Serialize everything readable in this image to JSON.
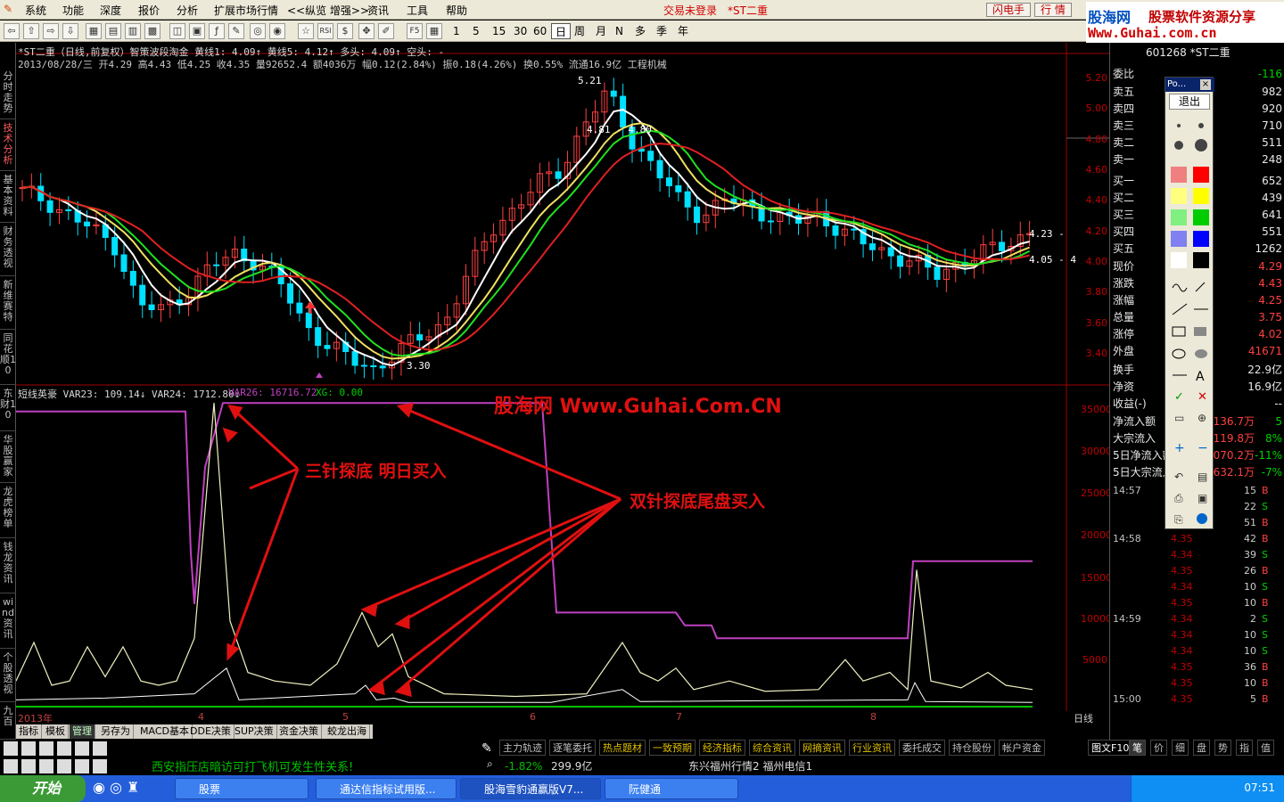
{
  "menu": {
    "items": [
      "系统",
      "功能",
      "深度",
      "报价",
      "分析",
      "扩展市场行情",
      "<<纵览 增强>>",
      "资讯",
      "工具",
      "帮助"
    ],
    "status": "交易未登录",
    "stock": "*ST二重",
    "btn_flash": "闪电手",
    "btn_quote": "行 情"
  },
  "brand": {
    "line1a": "股海网",
    "line1b": "股票软件资源分享",
    "line2": "Www.Guhai.com.cn"
  },
  "toolbar": {
    "periods": [
      "1",
      "5",
      "15",
      "30",
      "60",
      "日",
      "周",
      "月",
      "N",
      "多",
      "季",
      "年"
    ],
    "selected_period": "日",
    "icons": [
      "back-icon",
      "forward-icon",
      "up-icon",
      "down-icon",
      "home-icon",
      "list-icon",
      "chart-icon",
      "bars-icon",
      "draw-icon",
      "fx-icon",
      "find-icon",
      "star-icon",
      "rsi-icon",
      "money-icon",
      "move-icon",
      "pencil-icon",
      "f5-icon",
      "f6-icon",
      "f10-icon"
    ]
  },
  "leftnav": [
    "分时走势",
    "技术分析",
    "基本资料",
    "财务透视",
    "新维赛特",
    "同花顺10",
    "东财10",
    "华股赢家",
    "龙虎榜单",
    "钱龙资讯",
    "wind资讯",
    "个股透视",
    "九百"
  ],
  "chart": {
    "header1": "*ST二重（日线,前复权）智策波段淘金 黄线1: 4.09↑ 黄线5: 4.12↑ 多头: 4.09↑ 空头: -",
    "header2": "2013/08/28/三 开4.29 高4.43 低4.25 收4.35 量92652.4 额4036万 幅0.12(2.84%) 振0.18(4.26%) 换0.55% 流通16.9亿 工程机械",
    "ind_header_a": "短线英豪 VAR23: 109.14↓ VAR24: 1712.80↓",
    "ind_header_b": "VAR26: 16716.72",
    "ind_header_c": "XG: 0.00",
    "price_high": "5.21",
    "price_mid": "4.81 - 4.80",
    "price_low": "3.30",
    "price_last": "4.23 -",
    "price_right": "4.05 - 4",
    "watermark": "股海网 Www.Guhai.Com.CN",
    "annot1": "三针探底 明日买入",
    "annot2": "双针探底尾盘买入",
    "y1_ticks": [
      "5.20",
      "5.00",
      "4.80",
      "4.60",
      "4.40",
      "4.20",
      "4.00",
      "3.80",
      "3.60",
      "3.40"
    ],
    "y2_ticks": [
      "35000",
      "30000",
      "25000",
      "20000",
      "15000",
      "10000",
      "5000"
    ],
    "date_labels": [
      "2013年",
      "4",
      "5",
      "6",
      "7",
      "8"
    ],
    "period_label": "日线"
  },
  "tabs": [
    "指标",
    "模板",
    "管理",
    "另存为",
    "MACD基本",
    "DDE决策",
    "SUP决策",
    "资金决策",
    "蛟龙出海"
  ],
  "active_tab": "管理",
  "bottom_tabs": [
    "主力轨迹",
    "逐笔委托",
    "热点题材",
    "一致预期",
    "经济指标",
    "综合资讯",
    "网摘资讯",
    "行业资讯",
    "委托成交",
    "持仓股份",
    "帐户资金"
  ],
  "ticker": "西安指压店暗访可打飞机可发生性关系!",
  "index_change": "-1.82%",
  "index_amount": "299.9亿",
  "index_names": "东兴福州行情2  福州电信1",
  "right": {
    "code": "601268 *ST二重",
    "weibi_label": "委比",
    "weibi": "-116",
    "asks": [
      {
        "l": "卖五",
        "v": "982"
      },
      {
        "l": "卖四",
        "v": "920"
      },
      {
        "l": "卖三",
        "v": "710"
      },
      {
        "l": "卖二",
        "v": "511"
      },
      {
        "l": "卖一",
        "v": "248"
      }
    ],
    "bids": [
      {
        "l": "买一",
        "v": "652"
      },
      {
        "l": "买二",
        "v": "439"
      },
      {
        "l": "买三",
        "v": "641"
      },
      {
        "l": "买四",
        "v": "551"
      },
      {
        "l": "买五",
        "v": "1262"
      }
    ],
    "stats": [
      {
        "l": "现价",
        "v": "4.29"
      },
      {
        "l": "涨跌",
        "v": "4.43"
      },
      {
        "l": "涨幅",
        "v": "4.25"
      },
      {
        "l": "总量",
        "v": "3.75"
      },
      {
        "l": "涨停",
        "v": "4.02"
      },
      {
        "l": "外盘",
        "v": "41671"
      }
    ],
    "stats2": [
      {
        "l": "换手",
        "v": "22.9亿"
      },
      {
        "l": "净资",
        "v": "16.9亿"
      },
      {
        "l": "收益(-)",
        "v": "--"
      }
    ],
    "flows": [
      {
        "l": "净流入额",
        "v": "136.7万",
        "p": "5"
      },
      {
        "l": "大宗流入",
        "v": "119.8万",
        "p": "8%"
      },
      {
        "l": "5日净流入额",
        "v": "070.2万",
        "p": "-11%"
      },
      {
        "l": "5日大宗流入",
        "v": "632.1万",
        "p": "-7%"
      }
    ],
    "trades": [
      {
        "t": "14:57",
        "p": "",
        "v": "15",
        "f": "B"
      },
      {
        "t": "",
        "p": "",
        "v": "22",
        "f": "S"
      },
      {
        "t": "",
        "p": "",
        "v": "51",
        "f": "B"
      },
      {
        "t": "14:58",
        "p": "4.35",
        "v": "42",
        "f": "B"
      },
      {
        "t": "",
        "p": "4.34",
        "v": "39",
        "f": "S"
      },
      {
        "t": "",
        "p": "4.35",
        "v": "26",
        "f": "B"
      },
      {
        "t": "",
        "p": "4.34",
        "v": "10",
        "f": "S"
      },
      {
        "t": "",
        "p": "4.35",
        "v": "10",
        "f": "B"
      },
      {
        "t": "14:59",
        "p": "4.34",
        "v": "2",
        "f": "S"
      },
      {
        "t": "",
        "p": "4.34",
        "v": "10",
        "f": "S"
      },
      {
        "t": "",
        "p": "4.34",
        "v": "10",
        "f": "S"
      },
      {
        "t": "",
        "p": "4.35",
        "v": "36",
        "f": "B"
      },
      {
        "t": "",
        "p": "4.35",
        "v": "10",
        "f": "B"
      },
      {
        "t": "15:00",
        "p": "4.35",
        "v": "5",
        "f": "B"
      }
    ],
    "rtabs": [
      "笔",
      "价",
      "细",
      "盘",
      "势",
      "指",
      "值"
    ],
    "rtab_label": "图文F10"
  },
  "palette": {
    "title": "Po...",
    "exit": "退出"
  },
  "taskbar": {
    "start": "开始",
    "tasks": [
      "股票",
      "通达信指标试用版...",
      "股海雪豹通赢版V7...",
      "阮健通"
    ],
    "time": "07:51"
  },
  "colors": {
    "up": "#ff4040",
    "down": "#00e0ff",
    "ma_red": "#e02020",
    "ma_green": "#20e020",
    "ma_yellow": "#f0e060",
    "ma_white": "#ffffff",
    "purple": "#c040c0"
  }
}
